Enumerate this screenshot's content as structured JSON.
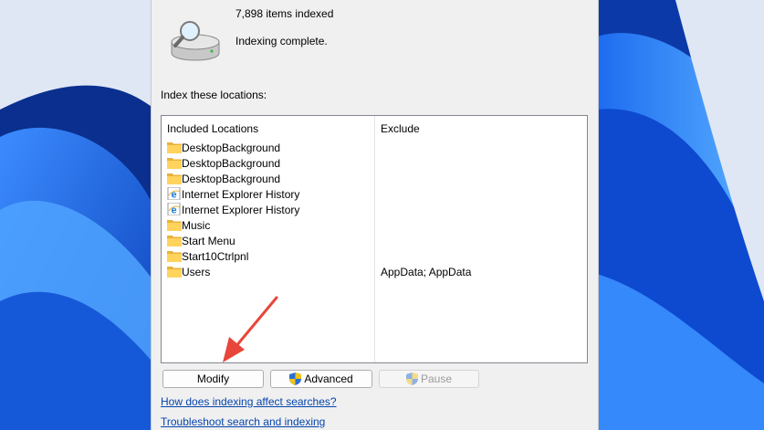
{
  "status": {
    "items_indexed": "7,898 items indexed",
    "state": "Indexing complete."
  },
  "locations": {
    "section_label": "Index these locations:",
    "headers": {
      "included": "Included Locations",
      "exclude": "Exclude"
    },
    "rows": [
      {
        "name": "DesktopBackground",
        "icon": "folder-icon",
        "exclude": ""
      },
      {
        "name": "DesktopBackground",
        "icon": "folder-icon",
        "exclude": ""
      },
      {
        "name": "DesktopBackground",
        "icon": "folder-icon",
        "exclude": ""
      },
      {
        "name": "Internet Explorer History",
        "icon": "internet-explorer-icon",
        "exclude": ""
      },
      {
        "name": "Internet Explorer History",
        "icon": "internet-explorer-icon",
        "exclude": ""
      },
      {
        "name": "Music",
        "icon": "folder-icon",
        "exclude": ""
      },
      {
        "name": "Start Menu",
        "icon": "folder-icon",
        "exclude": ""
      },
      {
        "name": "Start10Ctrlpnl",
        "icon": "folder-icon",
        "exclude": ""
      },
      {
        "name": "Users",
        "icon": "folder-icon",
        "exclude": "AppData; AppData"
      }
    ]
  },
  "buttons": {
    "modify": "Modify",
    "advanced": "Advanced",
    "pause": "Pause"
  },
  "links": {
    "affect": "How does indexing affect searches?",
    "troubleshoot": "Troubleshoot search and indexing"
  },
  "colors": {
    "wallpaper": "#0a3fb8",
    "window_bg": "#f0f0f0",
    "link": "#0645ad",
    "annotation_arrow": "#e8463a"
  }
}
